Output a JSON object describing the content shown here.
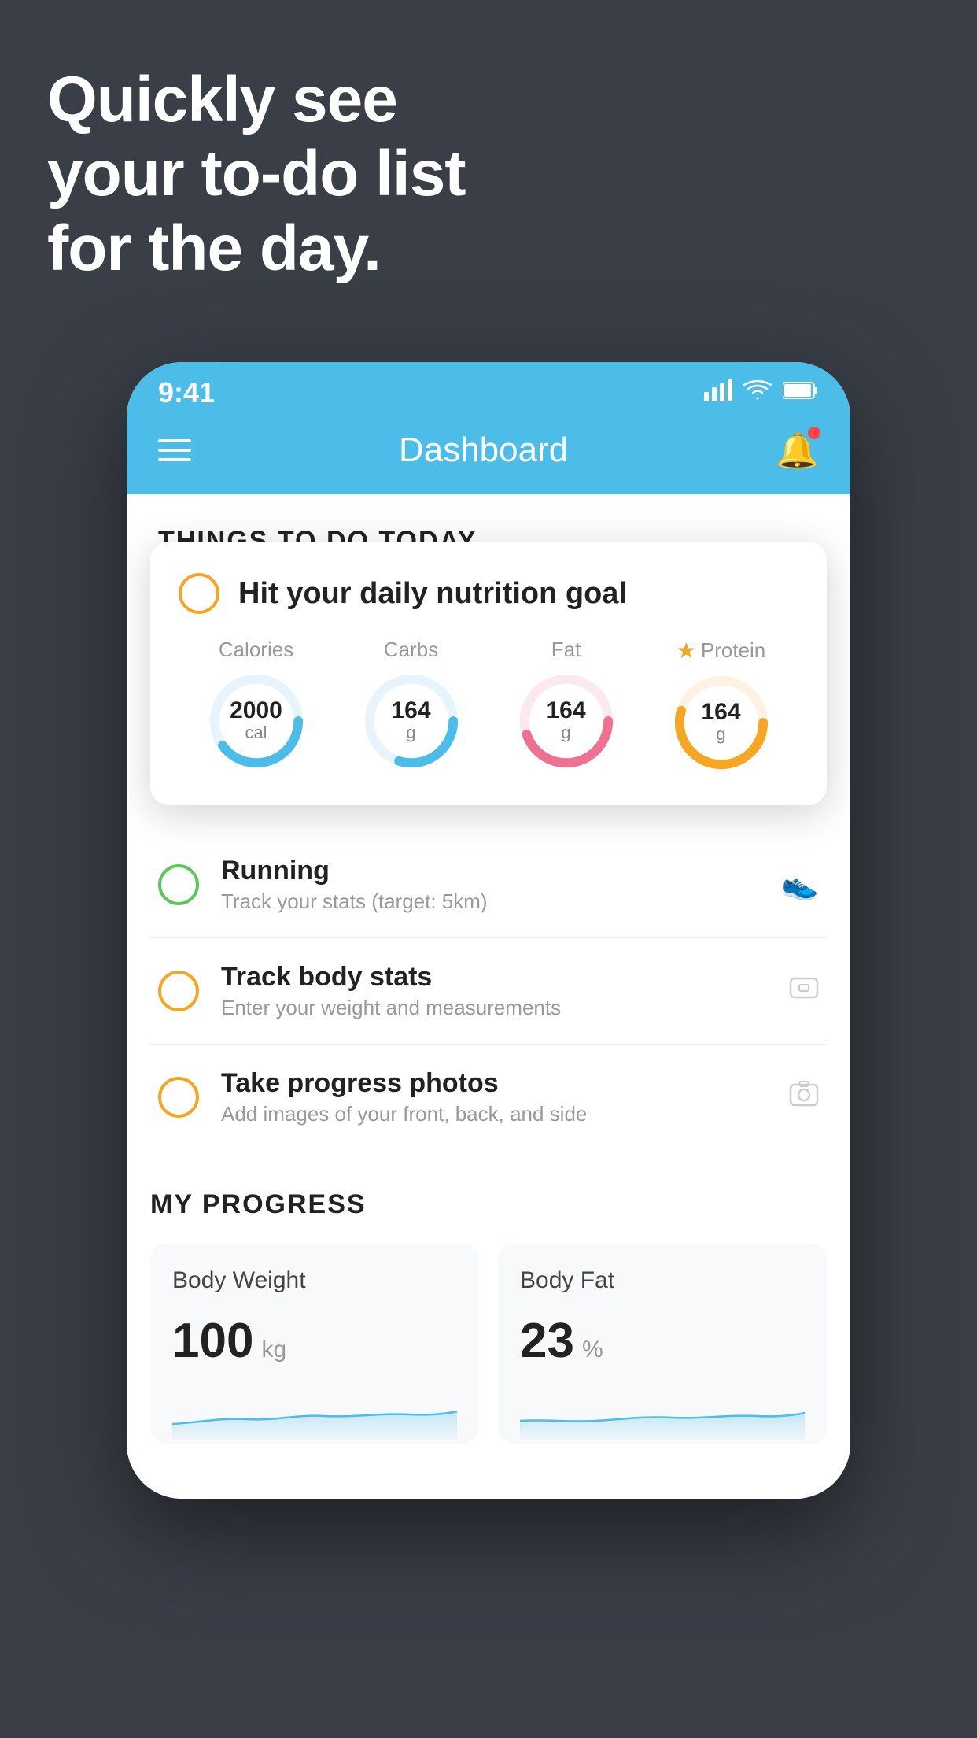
{
  "headline": {
    "line1": "Quickly see",
    "line2": "your to-do list",
    "line3": "for the day."
  },
  "statusBar": {
    "time": "9:41",
    "signal": "▌▌▌▌",
    "wifi": "wifi",
    "battery": "battery"
  },
  "nav": {
    "title": "Dashboard"
  },
  "thingsToDoSection": {
    "header": "THINGS TO DO TODAY"
  },
  "featuredCard": {
    "title": "Hit your daily nutrition goal",
    "stats": [
      {
        "label": "Calories",
        "value": "2000",
        "unit": "cal",
        "color": "#4bbde8",
        "pct": 65
      },
      {
        "label": "Carbs",
        "value": "164",
        "unit": "g",
        "color": "#4bbde8",
        "pct": 55
      },
      {
        "label": "Fat",
        "value": "164",
        "unit": "g",
        "color": "#f07090",
        "pct": 70
      },
      {
        "label": "Protein",
        "value": "164",
        "unit": "g",
        "color": "#f5a623",
        "pct": 80,
        "starred": true
      }
    ]
  },
  "todoItems": [
    {
      "title": "Running",
      "subtitle": "Track your stats (target: 5km)",
      "circleColor": "green",
      "icon": "👟"
    },
    {
      "title": "Track body stats",
      "subtitle": "Enter your weight and measurements",
      "circleColor": "yellow",
      "icon": "⚖️"
    },
    {
      "title": "Take progress photos",
      "subtitle": "Add images of your front, back, and side",
      "circleColor": "yellow",
      "icon": "🖼️"
    }
  ],
  "progressSection": {
    "header": "MY PROGRESS",
    "cards": [
      {
        "title": "Body Weight",
        "value": "100",
        "unit": "kg"
      },
      {
        "title": "Body Fat",
        "value": "23",
        "unit": "%"
      }
    ]
  }
}
